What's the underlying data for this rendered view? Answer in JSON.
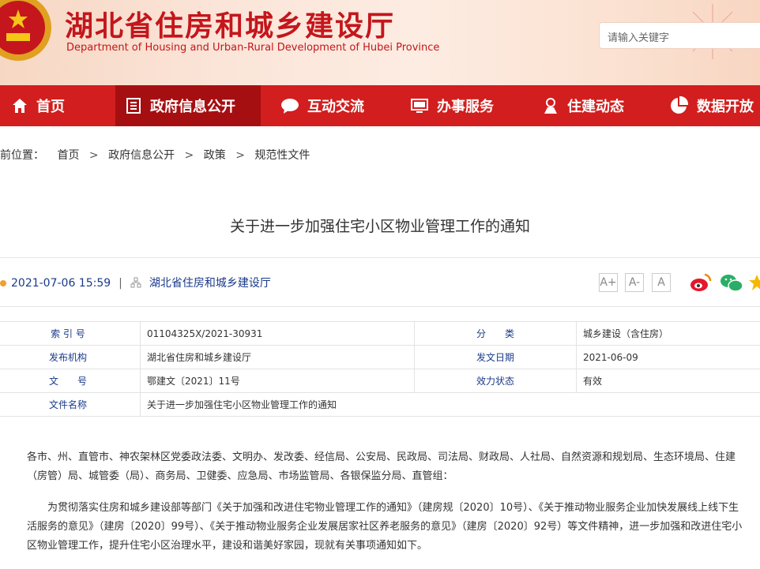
{
  "header": {
    "title": "湖北省住房和城乡建设厅",
    "subtitle": "Department of Housing and Urban-Rural Development of Hubei Province",
    "search_placeholder": "请输入关键字"
  },
  "nav": {
    "items": [
      {
        "label": "首页",
        "icon": "home-icon"
      },
      {
        "label": "政府信息公开",
        "icon": "document-list-icon"
      },
      {
        "label": "互动交流",
        "icon": "chat-bubble-icon"
      },
      {
        "label": "办事服务",
        "icon": "monitor-icon"
      },
      {
        "label": "住建动态",
        "icon": "person-icon"
      },
      {
        "label": "数据开放",
        "icon": "pie-chart-icon"
      }
    ],
    "active": "政府信息公开"
  },
  "breadcrumb": {
    "prefix": "前位置：",
    "items": [
      "首页",
      "政府信息公开",
      "政策",
      "规范性文件"
    ]
  },
  "article": {
    "title": "关于进一步加强住宅小区物业管理工作的通知",
    "datetime": "2021-07-06 15:59",
    "source": "湖北省住房和城乡建设厅",
    "font_buttons": [
      "A+",
      "A-",
      "A"
    ]
  },
  "info_table": {
    "index_label": "索 引 号",
    "index_value": "01104325X/2021-30931",
    "category_label": "分　　类",
    "category_value": "城乡建设（含住房）",
    "issuer_label": "发布机构",
    "issuer_value": "湖北省住房和城乡建设厅",
    "date_label": "发文日期",
    "date_value": "2021-06-09",
    "docno_label": "文　　号",
    "docno_value": "鄂建文〔2021〕11号",
    "status_label": "效力状态",
    "status_value": "有效",
    "name_label": "文件名称",
    "name_value": "关于进一步加强住宅小区物业管理工作的通知"
  },
  "body": {
    "recipients": "各市、州、直管市、神农架林区党委政法委、文明办、发改委、经信局、公安局、民政局、司法局、财政局、人社局、自然资源和规划局、生态环境局、住建（房管）局、城管委（局）、商务局、卫健委、应急局、市场监管局、各银保监分局、直管组：",
    "intro": "为贯彻落实住房和城乡建设部等部门《关于加强和改进住宅物业管理工作的通知》（建房规〔2020〕10号）、《关于推动物业服务企业加快发展线上线下生活服务的意见》（建房〔2020〕99号）、《关于推动物业服务企业发展居家社区养老服务的意见》（建房〔2020〕92号）等文件精神，进一步加强和改进住宅小区物业管理工作，提升住宅小区治理水平，建设和谐美好家园，现就有关事项通知如下。"
  },
  "colors": {
    "brand_red": "#d21e1e",
    "active_red": "#a60f12",
    "link_blue": "#1a3a8a"
  }
}
